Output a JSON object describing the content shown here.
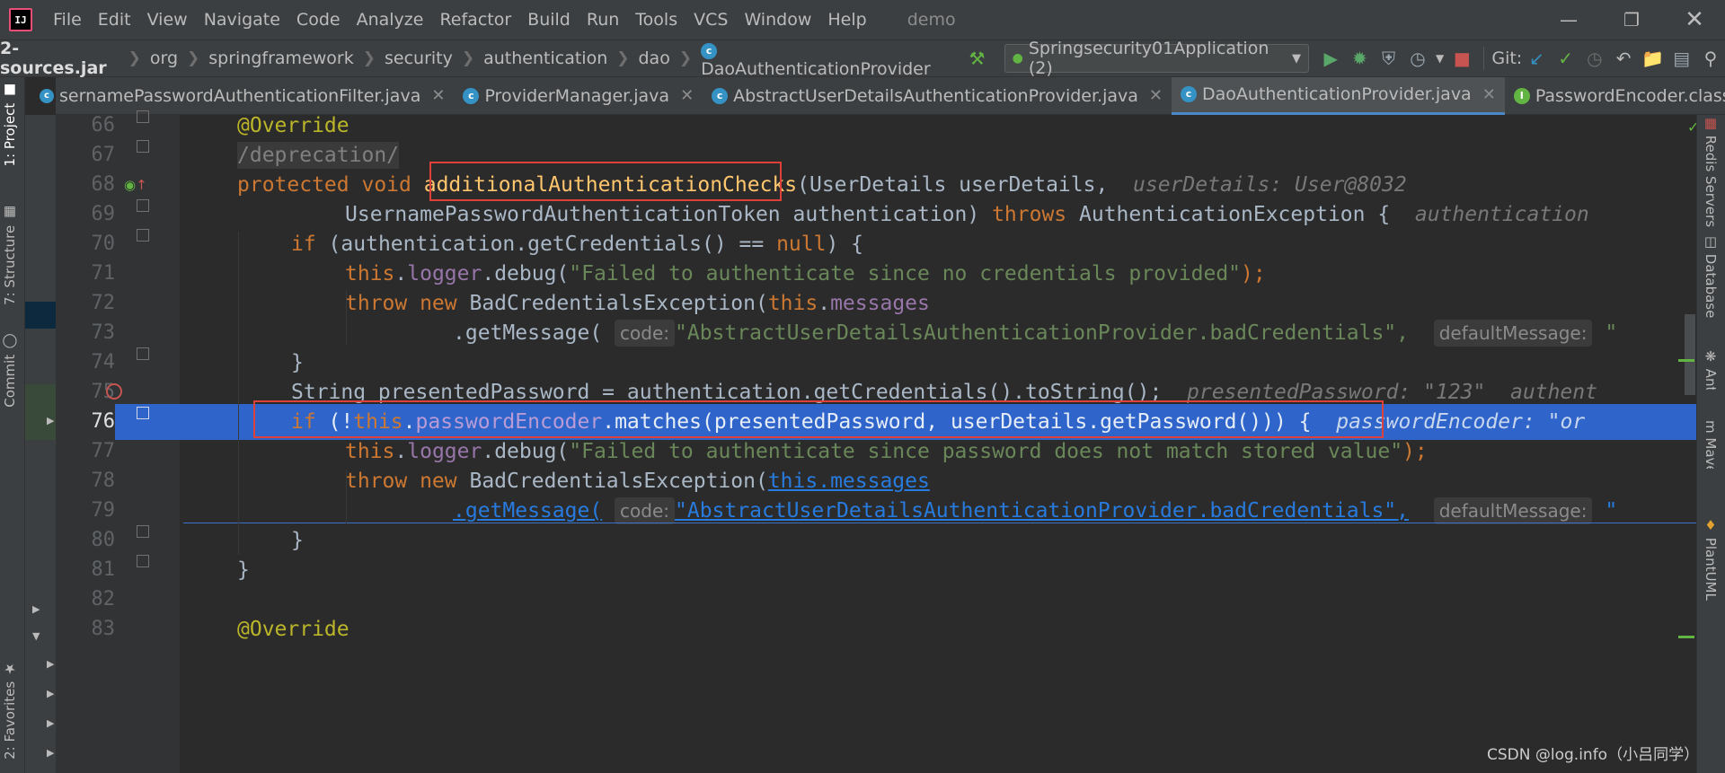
{
  "menu": {
    "logo": "IJ",
    "items": [
      "File",
      "Edit",
      "View",
      "Navigate",
      "Code",
      "Analyze",
      "Refactor",
      "Build",
      "Run",
      "Tools",
      "VCS",
      "Window",
      "Help"
    ],
    "app_name": "demo"
  },
  "breadcrumb": [
    "2-sources.jar",
    "org",
    "springframework",
    "security",
    "authentication",
    "dao",
    "DaoAuthenticationProvider"
  ],
  "run_config": "Springsecurity01Application (2)",
  "git_label": "Git:",
  "tabs": [
    {
      "label": "sernamePasswordAuthenticationFilter.java",
      "icon": "class-icon"
    },
    {
      "label": "ProviderManager.java",
      "icon": "class-icon"
    },
    {
      "label": "AbstractUserDetailsAuthenticationProvider.java",
      "icon": "class-icon"
    },
    {
      "label": "DaoAuthenticationProvider.java",
      "icon": "class-icon",
      "active": true
    },
    {
      "label": "PasswordEncoder.class",
      "icon": "interface-icon"
    }
  ],
  "left_tool_tabs": [
    "1: Project",
    "7: Structure",
    "Commit",
    "2: Favorites"
  ],
  "right_tool_tabs": [
    "Redis Servers",
    "Database",
    "Ant",
    "Maven",
    "PlantUML"
  ],
  "line_numbers": [
    "66",
    "67",
    "68",
    "69",
    "70",
    "71",
    "72",
    "73",
    "74",
    "75",
    "76",
    "77",
    "78",
    "79",
    "80",
    "81",
    "82",
    "83"
  ],
  "code": {
    "l66": "@Override",
    "l67": "/deprecation/",
    "l68_kw": "protected void ",
    "l68_method": "additionalAuthenticationChecks",
    "l68_rest": "(UserDetails userDetails,",
    "l68_hint": "userDetails: User@8032",
    "l69_a": "UsernamePasswordAuthenticationToken authentication) ",
    "l69_kw": "throws",
    "l69_b": " AuthenticationException {",
    "l69_hint": "authentication",
    "l70_kw": "if",
    "l70_a": " (authentication.getCredentials() == ",
    "l70_null": "null",
    "l70_b": ") {",
    "l71_this": "this",
    "l71_dot": ".",
    "l71_field": "logger",
    "l71_call": ".debug(",
    "l71_str": "\"Failed to authenticate since no credentials provided\"",
    "l71_end": ");",
    "l72_kw": "throw new ",
    "l72_cls": "BadCredentialsException(",
    "l72_this": "this",
    "l72_dot": ".",
    "l72_field": "messages",
    "l73_call": ".getMessage(",
    "l73_ph1": "code:",
    "l73_str": "\"AbstractUserDetailsAuthenticationProvider.badCredentials\",",
    "l73_ph2": "defaultMessage:",
    "l73_tail": "\"",
    "l74": "}",
    "l75_a": "String presentedPassword = authentication.getCredentials().toString();",
    "l75_hint": "presentedPassword: \"123\"  authent",
    "l76_kw": "if",
    "l76_a": " (!",
    "l76_this": "this",
    "l76_dot": ".",
    "l76_field": "passwordEncoder",
    "l76_b": ".matches(presentedPassword, userDetails.getPassword())) {",
    "l76_hint": "passwordEncoder: \"or",
    "l77_this": "this",
    "l77_dot": ".",
    "l77_field": "logger",
    "l77_call": ".debug(",
    "l77_str": "\"Failed to authenticate since password does not match stored value\"",
    "l77_end": ");",
    "l78_kw": "throw new ",
    "l78_cls": "BadCredentialsException(",
    "l78_link": "this.messages",
    "l79_call": ".getMessage(",
    "l79_ph1": "code:",
    "l79_str": "\"AbstractUserDetailsAuthenticationProvider.badCredentials\",",
    "l79_ph2": "defaultMessage:",
    "l79_tail": "\"",
    "l80": "}",
    "l81": "}",
    "l83": "@Override"
  },
  "watermark": "CSDN @log.info（小吕同学）",
  "colors": {
    "editor_bg": "#2b2b2b",
    "keyword": "#cc7832",
    "string": "#6a8759",
    "field": "#9876aa",
    "method_decl": "#ffc66d",
    "annotation": "#bbb529",
    "selection": "#2f65ca",
    "highlight_box": "#e0403a"
  }
}
